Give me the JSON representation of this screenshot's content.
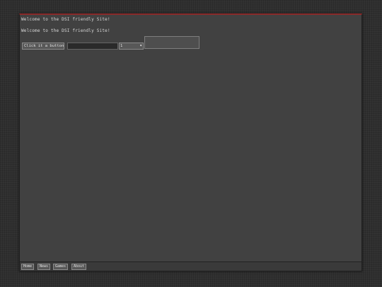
{
  "page": {
    "welcome_line_1": "Welcome to the DSI friendly Site!",
    "welcome_line_2": "Welcome to the DSI friendly Site!"
  },
  "controls": {
    "say_button_label": "Click it a button",
    "text_input_value": "",
    "select_value": "1"
  },
  "footer": {
    "nav": [
      {
        "label": "Home"
      },
      {
        "label": "News"
      },
      {
        "label": "Games"
      },
      {
        "label": "About"
      }
    ]
  },
  "theme": {
    "background": "#2f2f2f",
    "panel": "#414141",
    "accent_top": "#8a2a2a"
  }
}
